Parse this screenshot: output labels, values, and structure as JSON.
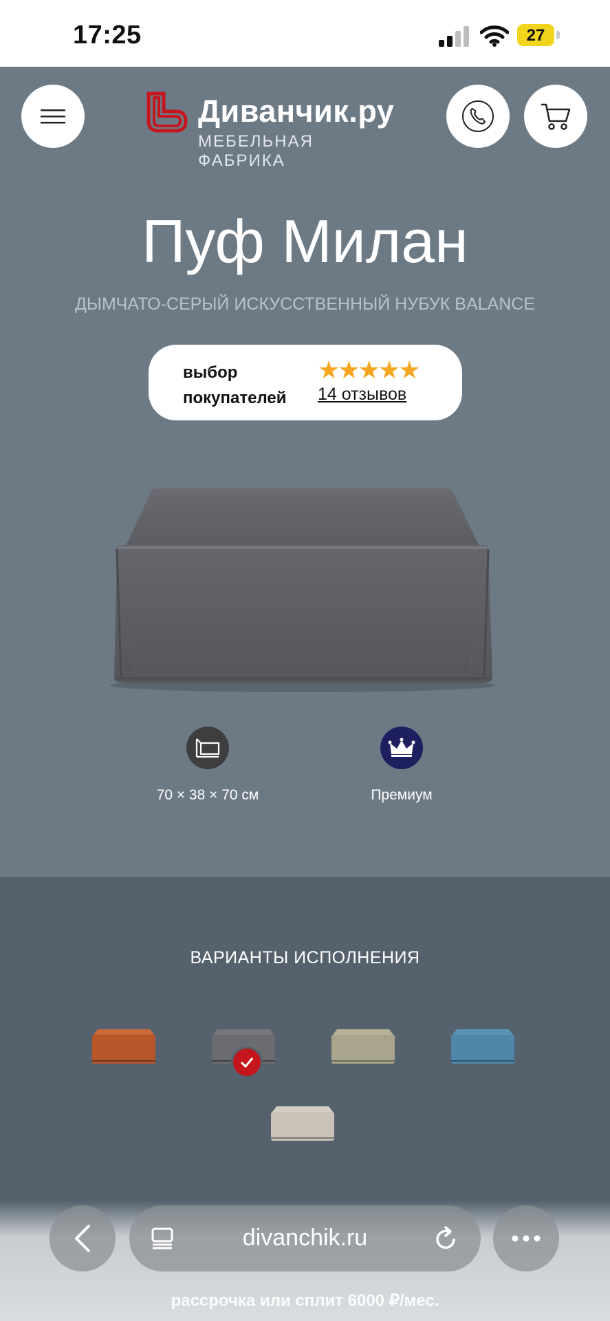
{
  "status_bar": {
    "time": "17:25",
    "battery": "27"
  },
  "header": {
    "logo_name": "Диванчик.ру",
    "logo_tagline": "МЕБЕЛЬНАЯ ФАБРИКА",
    "menu_icon": "hamburger-icon",
    "phone_icon": "phone-icon",
    "cart_icon": "cart-icon"
  },
  "product": {
    "title": "Пуф Милан",
    "subtitle": "ДЫМЧАТО-СЕРЫЙ ИСКУССТВЕННЫЙ НУБУК BALANCE",
    "badge_line1": "выбор",
    "badge_line2": "покупателей",
    "stars": "★★★★★",
    "rating": 5,
    "reviews_link": "14 отзывов",
    "features": [
      {
        "icon": "dimensions-icon",
        "label": "70 × 38 × 70 см"
      },
      {
        "icon": "crown-icon",
        "label": "Премиум"
      }
    ]
  },
  "variants": {
    "title": "ВАРИАНТЫ ИСПОЛНЕНИЯ",
    "items": [
      {
        "color": "#b8562a",
        "selected": false
      },
      {
        "color": "#6b6b72",
        "selected": true
      },
      {
        "color": "#a8a58c",
        "selected": false
      },
      {
        "color": "#4f87aa",
        "selected": false
      },
      {
        "color": "#c9c2b8",
        "selected": false
      }
    ]
  },
  "browser": {
    "url": "divanchik.ru",
    "promo": "рассрочка или сплит 6000 ₽/мес."
  },
  "colors": {
    "hero_bg": "#6c7a86",
    "variants_bg": "#55626d",
    "brand_red": "#c4161c",
    "star": "#f5a623",
    "crown_badge": "#1e1f5e"
  }
}
